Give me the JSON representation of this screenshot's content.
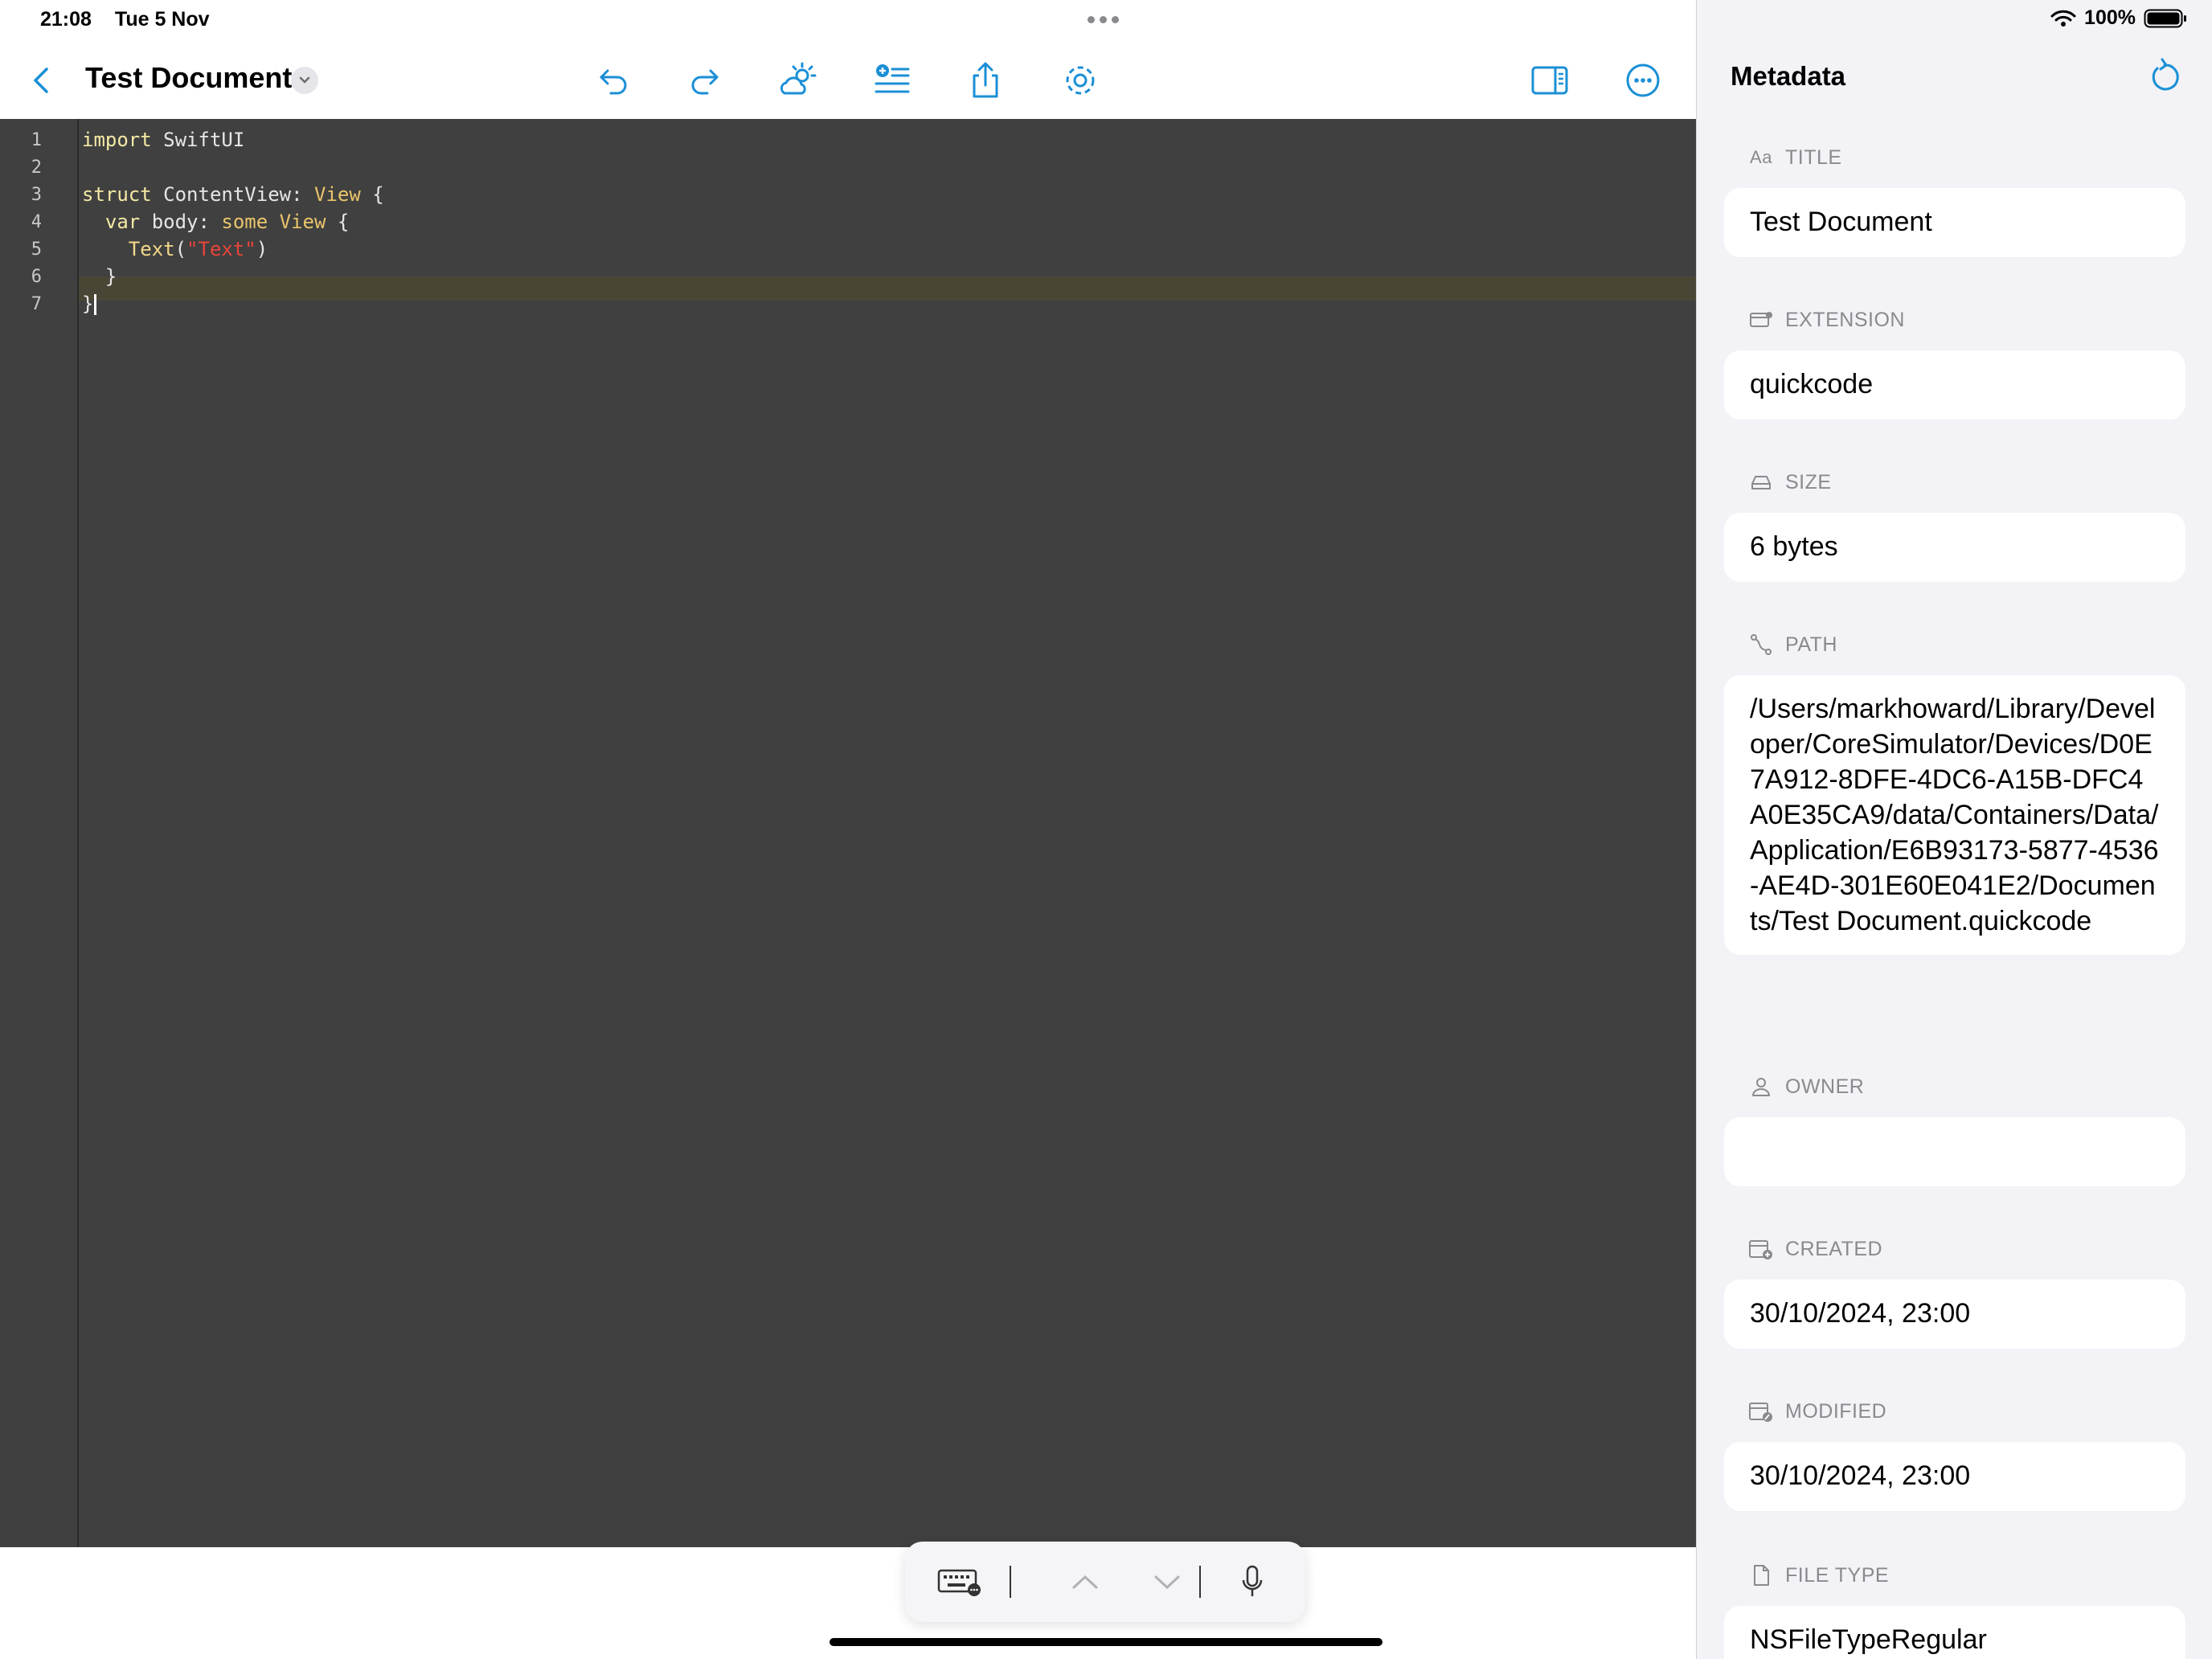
{
  "status_bar": {
    "time": "21:08",
    "date": "Tue 5 Nov",
    "battery": "100%"
  },
  "toolbar": {
    "document_title": "Test Document"
  },
  "editor": {
    "line_numbers": [
      "1",
      "2",
      "3",
      "4",
      "5",
      "6",
      "7"
    ],
    "lines": [
      [
        {
          "t": "import",
          "c": "kw"
        },
        {
          "t": " SwiftUI",
          "c": ""
        }
      ],
      [],
      [
        {
          "t": "struct",
          "c": "kw"
        },
        {
          "t": " ContentView: ",
          "c": ""
        },
        {
          "t": "View",
          "c": "ty"
        },
        {
          "t": " {",
          "c": ""
        }
      ],
      [
        {
          "t": "  var",
          "c": "kw"
        },
        {
          "t": " body: ",
          "c": ""
        },
        {
          "t": "some",
          "c": "ty"
        },
        {
          "t": " ",
          "c": ""
        },
        {
          "t": "View",
          "c": "ty"
        },
        {
          "t": " {",
          "c": ""
        }
      ],
      [
        {
          "t": "    Text",
          "c": "fn"
        },
        {
          "t": "(",
          "c": ""
        },
        {
          "t": "\"Text\"",
          "c": "st"
        },
        {
          "t": ")",
          "c": ""
        }
      ],
      [
        {
          "t": "  }",
          "c": ""
        }
      ],
      [
        {
          "t": "}",
          "c": ""
        }
      ]
    ]
  },
  "sidebar": {
    "title": "Metadata",
    "fields": [
      {
        "label": "TITLE",
        "icon": "text-size-icon",
        "glyph": "Aa",
        "value": "Test Document"
      },
      {
        "label": "EXTENSION",
        "icon": "extension-icon",
        "glyph": "",
        "value": "quickcode"
      },
      {
        "label": "SIZE",
        "icon": "drive-icon",
        "glyph": "",
        "value": "6 bytes"
      },
      {
        "label": "PATH",
        "icon": "path-icon",
        "glyph": "",
        "value": "/Users/markhoward/Library/Developer/CoreSimulator/Devices/D0E7A912-8DFE-4DC6-A15B-DFC4A0E35CA9/data/Containers/Data/Application/E6B93173-5877-4536-AE4D-301E60E041E2/Documents/Test Document.quickcode"
      },
      {
        "label": "OWNER",
        "icon": "person-icon",
        "glyph": "",
        "value": ""
      },
      {
        "label": "CREATED",
        "icon": "calendar-plus-icon",
        "glyph": "",
        "value": "30/10/2024, 23:00"
      },
      {
        "label": "MODIFIED",
        "icon": "calendar-edit-icon",
        "glyph": "",
        "value": "30/10/2024, 23:00"
      },
      {
        "label": "FILE TYPE",
        "icon": "document-icon",
        "glyph": "",
        "value": "NSFileTypeRegular"
      }
    ]
  },
  "colors": {
    "accent": "#1a8fd6",
    "editor_bg": "#404040",
    "sidebar_bg": "#f2f2f7"
  }
}
